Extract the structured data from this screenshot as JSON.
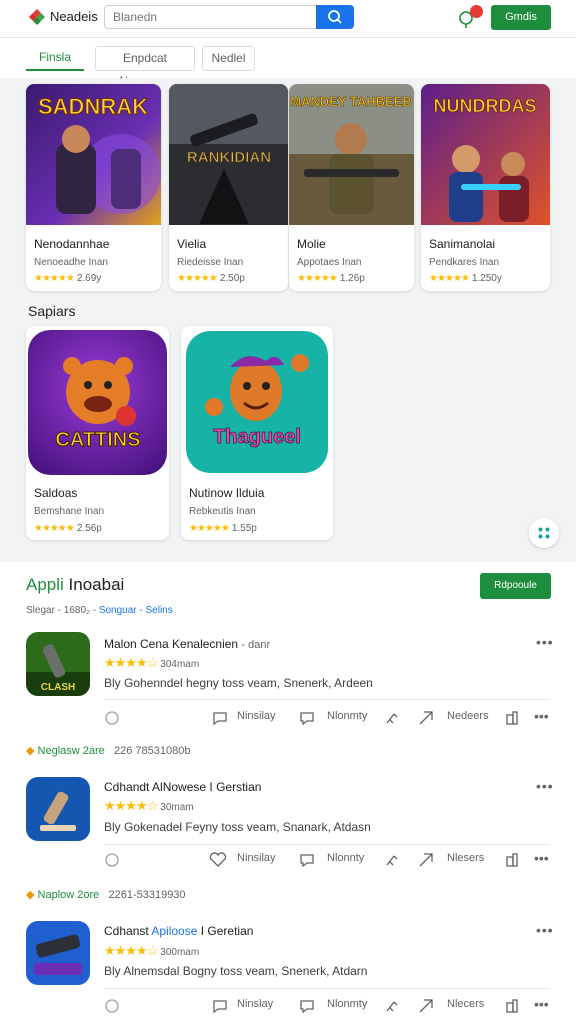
{
  "header": {
    "brand": "Neadeis",
    "search_placeholder": "Blanedn",
    "primary_button": "Gmdis"
  },
  "tabs": [
    "Finsla",
    "Enpdcat Nemguns",
    "Nedlel"
  ],
  "featured": [
    {
      "art_text": "SADNRAK",
      "title": "Nenodannhae",
      "subtitle": "Nenoeadhe Inan",
      "rating": "2.69y"
    },
    {
      "art_text": "RANKIDIAN",
      "title": "Vielia",
      "subtitle": "Riedeisse Inan",
      "rating": "2.50p"
    },
    {
      "art_text": "MANDEY TAHBEEB",
      "title": "Molie",
      "subtitle": "Appotaes Inan",
      "rating": "1.26p"
    },
    {
      "art_text": "NUNDRDAS",
      "title": "Sanimanolai",
      "subtitle": "Pendkares Inan",
      "rating": "1.250y"
    }
  ],
  "section_title": "Sapiars",
  "sapiars": [
    {
      "art_text": "CATTINS",
      "title": "Saldoas",
      "subtitle": "Bemshane Inan",
      "rating": "2.56p"
    },
    {
      "art_text": "Thagueel",
      "title": "Nutinow Ilduia",
      "subtitle": "Rebkeutis Inan",
      "rating": "1.55p"
    }
  ],
  "apps": {
    "title_prefix": "Appli",
    "title_rest": " Inoabai",
    "button": "Rdpooule",
    "crumbs_prefix": "Slegar  -  1680₂ -",
    "crumbs_link": "Songuar - Selins"
  },
  "list": [
    {
      "title": "Malon Cena Kenalecnien",
      "extra": "- danr",
      "rating": "304mam",
      "desc": "Bly Gohenndel hegny toss veam, Snenerk, Ardeen",
      "actions": [
        "Ninsilay",
        "Nlonmty",
        "Nedeers"
      ]
    },
    {
      "group_tag": "Neglasw 2are",
      "group_meta": "226 78531080b"
    },
    {
      "title": "Cdhandt AlNowese I Gerstian",
      "extra": "",
      "rating": "30mam",
      "desc": "Bly Gokenadel Feyny toss veam, Snanark, Atdasn",
      "actions": [
        "Ninsilay",
        "Nlonnty",
        "Nlesers"
      ]
    },
    {
      "group_tag": "Naplow 2ore",
      "group_meta": "2261-53319930"
    },
    {
      "title_a": "Cdhanst ",
      "title_hl": "Apiloose",
      "title_b": " I Geretian",
      "rating": "300mam",
      "desc": "Bly Alnemsdal Bogny toss veam, Snenerk, Atdarn",
      "actions": [
        "Ninslay",
        "Nlonmty",
        "Nlecers"
      ]
    }
  ],
  "colors": {
    "accent_green": "#1e8e3e",
    "accent_blue": "#1a73e8",
    "star": "#fbbc04"
  }
}
